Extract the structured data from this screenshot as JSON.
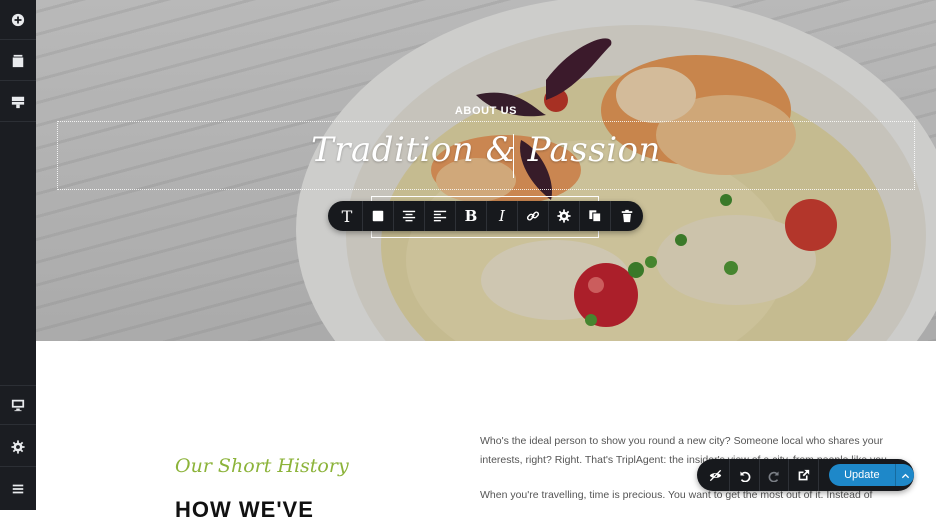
{
  "sidebar": {
    "top_items": [
      {
        "icon": "add-icon"
      },
      {
        "icon": "pages-icon"
      },
      {
        "icon": "layout-icon"
      }
    ],
    "bottom_items": [
      {
        "icon": "desktop-icon"
      },
      {
        "icon": "gear-icon"
      },
      {
        "icon": "menu-icon"
      }
    ]
  },
  "hero": {
    "eyebrow": "ABOUT US",
    "title": "Tradition & Passion"
  },
  "text_toolbar": {
    "items": [
      "text-style-icon",
      "color-icon",
      "align-center-icon",
      "align-left-icon",
      "bold-icon",
      "italic-icon",
      "link-icon",
      "gear-icon",
      "duplicate-icon",
      "delete-icon"
    ]
  },
  "content": {
    "history_label": "Our Short History",
    "history_heading": "HOW WE'VE",
    "paragraph1": "Who's the ideal person to show you round a new city? Someone local who shares your interests, right? Right. That's TriplAgent: the insider's view of a city, from people like you.",
    "paragraph2": "When you're travelling, time is precious. You want to get the most out of it. Instead of"
  },
  "action_bar": {
    "update_label": "Update",
    "accent": "#1e88c9"
  }
}
